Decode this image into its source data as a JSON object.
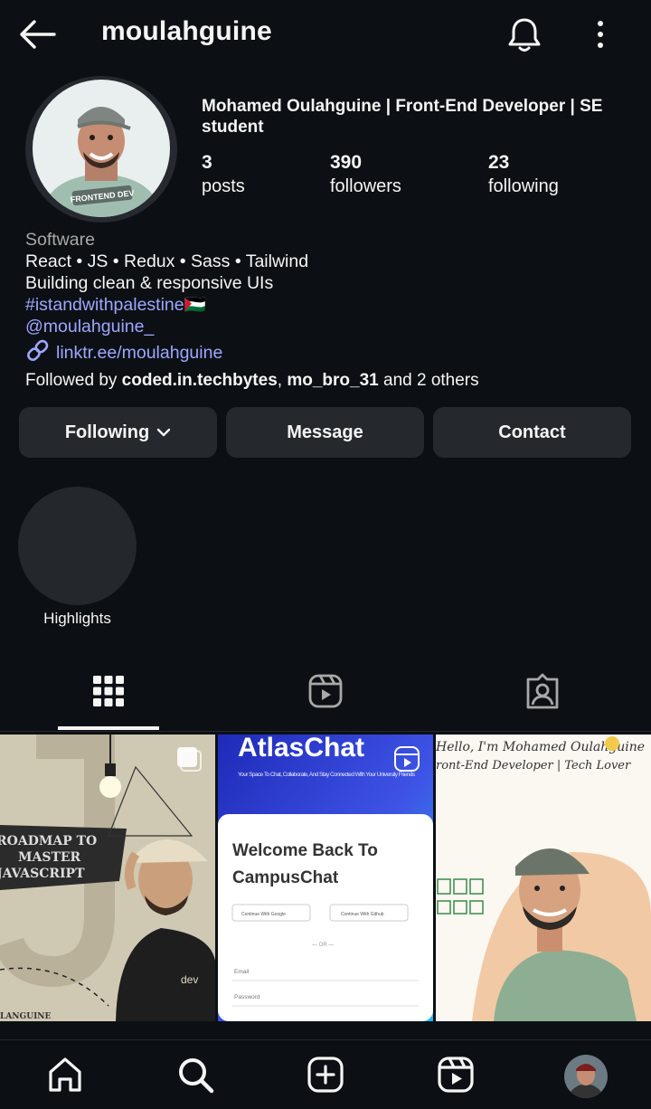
{
  "header": {
    "username": "moulahguine"
  },
  "profile": {
    "full_name": "Mohamed Oulahguine | Front-End Developer | SE student",
    "avatar_badge": "FRONTEND DEV",
    "stats": [
      {
        "value": "3",
        "label": "posts"
      },
      {
        "value": "390",
        "label": "followers"
      },
      {
        "value": "23",
        "label": "following"
      }
    ],
    "category": "Software",
    "bio_lines": [
      "React • JS • Redux • Sass • Tailwind",
      "Building clean & responsive UIs"
    ],
    "hashtag": "#istandwithpalestine🇵🇸",
    "mention": "@moulahguine_",
    "link": "linktr.ee/moulahguine",
    "followed_by": {
      "prefix": "Followed by ",
      "user1": "coded.in.techbytes",
      "sep": ", ",
      "user2": "mo_bro_31",
      "suffix": " and ",
      "others": "2 others"
    }
  },
  "actions": {
    "following": "Following",
    "message": "Message",
    "contact": "Contact"
  },
  "highlights": {
    "label": "Highlights"
  },
  "posts": [
    {
      "texts": [
        "ROADMAP TO",
        "MASTER",
        "JAVASCRIPT",
        "dev",
        "LANGUINE"
      ]
    },
    {
      "texts": [
        "AtlasChat",
        "Your Space To Chat, Collaborate, And Stay Connected With Your University Friends",
        "Welcome Back To",
        "CampusChat",
        "Continue With Google",
        "Continue With Github",
        "— OR —",
        "Email",
        "Password"
      ]
    },
    {
      "texts": [
        "Hello, I'm Mohamed Oulahguine",
        "ront-End Developer | Tech Lover"
      ]
    }
  ],
  "colors": {
    "background": "#0c1014",
    "button": "#25292e",
    "link": "#9da7ff",
    "muted": "#a8a8a8"
  }
}
